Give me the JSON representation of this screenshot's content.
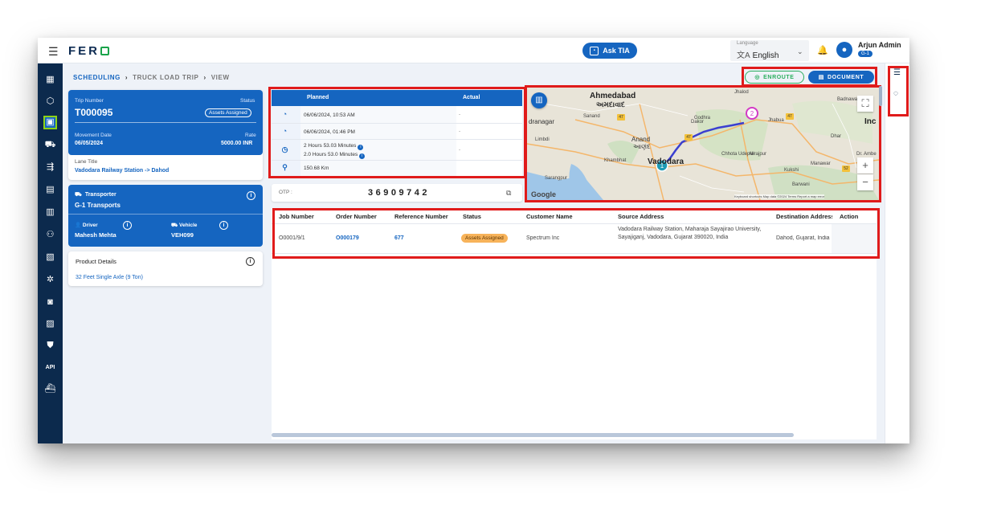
{
  "app": {
    "logo": "FER",
    "ask_tia": "Ask TIA"
  },
  "language": {
    "label": "Language",
    "value": "English"
  },
  "user": {
    "name": "Arjun Admin",
    "badge": "G-1"
  },
  "breadcrumb": {
    "items": [
      "SCHEDULING",
      "TRUCK LOAD TRIP",
      "VIEW"
    ]
  },
  "actions": {
    "enroute": "ENROUTE",
    "document": "DOCUMENT"
  },
  "trip": {
    "number_label": "Trip Number",
    "number": "T000095",
    "status_label": "Status",
    "status": "Assets Assigned",
    "movement_label": "Movement Date",
    "movement": "06/05/2024",
    "rate_label": "Rate",
    "rate": "5000.00 INR",
    "lane_label": "Lane Title",
    "lane": "Vadodara Railway Station -> Dahod"
  },
  "transporter": {
    "label": "Transporter",
    "name": "G-1 Transports",
    "driver_label": "Driver",
    "driver": "Mahesh Mehta",
    "vehicle_label": "Vehicle",
    "vehicle": "VEH099"
  },
  "product": {
    "label": "Product Details",
    "value": "32 Feet Single Axle (9 Ton)"
  },
  "schedule": {
    "planned_label": "Planned",
    "actual_label": "Actual",
    "start_planned": "06/06/2024, 10:53 AM",
    "end_planned": "06/06/2024, 01:46 PM",
    "duration_1": "2 Hours 53.03 Minutes",
    "duration_2": "2.0 Hours 53.0 Minutes",
    "distance": "150.68 Km",
    "actual_empty": "-"
  },
  "otp": {
    "label": "OTP :",
    "value": "36909742"
  },
  "map": {
    "labels": [
      "Ahmedabad",
      "અમદાવાદ",
      "Anand",
      "આણંદ",
      "Vadodara",
      "Godhra",
      "Jhalod",
      "Badnawar",
      "Kukshi",
      "Manawar",
      "Dhar",
      "Dr. Ambe",
      "Inc",
      "Barwani",
      "Khambhat",
      "Chhota Udepur",
      "Alirajpur",
      "Jhabua",
      "Dakor",
      "Sanand",
      "dranagar",
      "Limbdi",
      "Sarangpur"
    ],
    "markers": [
      "1",
      "2"
    ],
    "attribution": "Keyboard shortcuts   Map data ©2024   Terms   Report a map error",
    "google": "Google"
  },
  "jobs": {
    "headers": [
      "Job Number",
      "Order Number",
      "Reference Number",
      "Status",
      "Customer Name",
      "Source Address",
      "Destination Address",
      "Action"
    ],
    "rows": [
      {
        "job": "O0001/9/1",
        "order": "O000179",
        "reference": "677",
        "status": "Assets Assigned",
        "customer": "Spectrum Inc",
        "source": "Vadodara Railway Station, Maharaja Sayajirao University, Sayajiganj, Vadodara, Gujarat 390020, India",
        "destination": "Dahod, Gujarat, India"
      }
    ]
  },
  "colors": {
    "brand": "#1565c0",
    "sidebar": "#0c2a4d",
    "enroute": "#2bae5e",
    "status_badge": "#f7b35a",
    "highlight": "#e01b1b"
  }
}
